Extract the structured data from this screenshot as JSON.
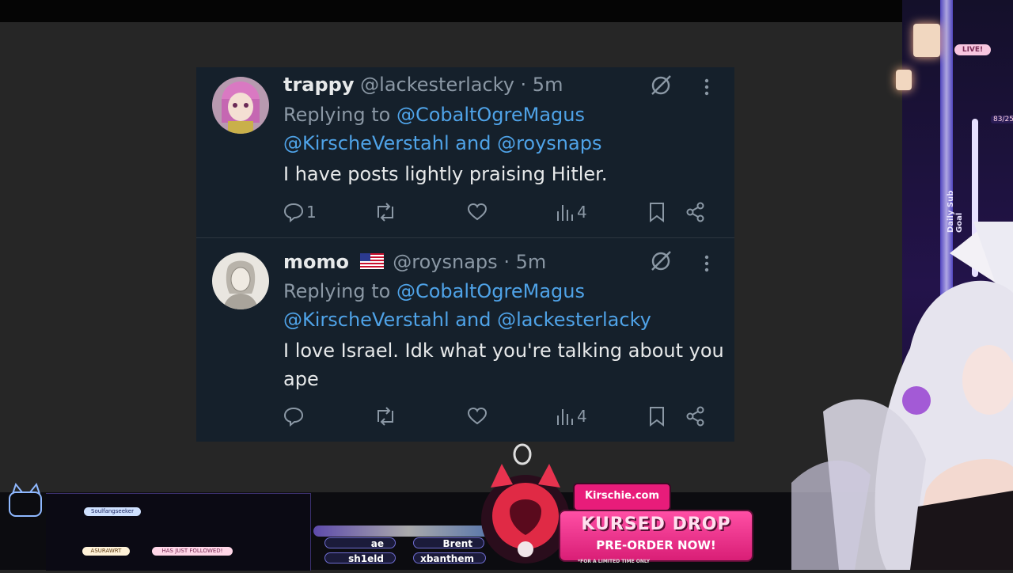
{
  "tweets": [
    {
      "display_name": "trappy",
      "handle": "@lackesterlacky",
      "time": "· 5m",
      "reply_prefix": "Replying to",
      "mention_1": "@CobaltOgreMagus",
      "mention_2": "@KirscheVerstahl",
      "joiner": "and",
      "mention_3": "@roysnaps",
      "text": "I have posts lightly praising Hitler.",
      "reply_count": "1",
      "views": "4"
    },
    {
      "display_name": "momo",
      "flag": "🇺🇸",
      "handle": "@roysnaps",
      "time": "· 5m",
      "reply_prefix": "Replying to",
      "mention_1": "@CobaltOgreMagus",
      "mention_2": "@KirscheVerstahl",
      "joiner": "and",
      "mention_3": "@lackesterlacky",
      "text": "I love Israel. Idk what you're talking about you ape",
      "reply_count": "",
      "views": "4"
    }
  ],
  "overlay": {
    "live_badge": "LIVE!",
    "sub_goal_label": "Daily Sub Goal",
    "sub_goal_count": "83/25",
    "chat_user_1": "Soulfangseeker",
    "chat_user_2": "ASURAWRT",
    "chat_event": "HAS JUST FOLLOWED!",
    "name_1": "ae",
    "name_2": "Brent",
    "name_3": "sh1eld",
    "name_4": "xbanthem",
    "brand": "Kirschie.com",
    "drop_title": "KURSED DROP",
    "drop_subtitle": "PRE-ORDER NOW!",
    "drop_fine": "*FOR A LIMITED TIME ONLY"
  },
  "colors": {
    "panel_bg": "#15202b",
    "mention_blue": "#4fa3e8",
    "muted_text": "#8b98a5",
    "primary_text": "#e7e9ea",
    "page_bg": "#262626"
  },
  "icons": [
    "grok-icon",
    "more-icon",
    "reply-icon",
    "retweet-icon",
    "like-icon",
    "views-icon",
    "bookmark-icon",
    "share-icon"
  ]
}
